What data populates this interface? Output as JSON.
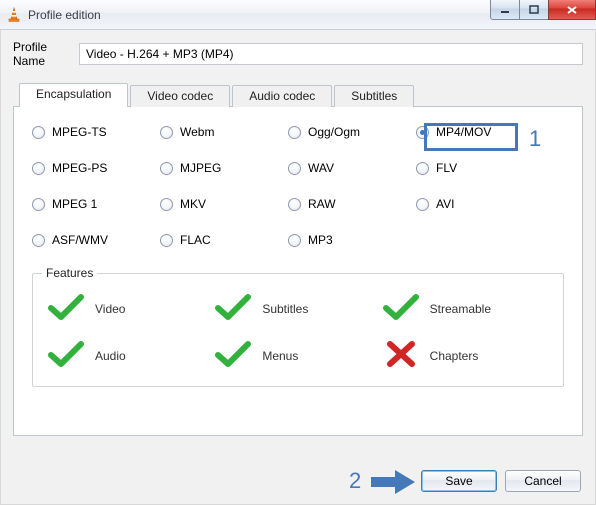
{
  "window": {
    "title": "Profile edition",
    "app_icon": "vlc-cone-icon"
  },
  "profile": {
    "name_label": "Profile Name",
    "name_value": "Video - H.264 + MP3 (MP4)"
  },
  "tabs": [
    {
      "id": "encapsulation",
      "label": "Encapsulation",
      "active": true
    },
    {
      "id": "video_codec",
      "label": "Video codec",
      "active": false
    },
    {
      "id": "audio_codec",
      "label": "Audio codec",
      "active": false
    },
    {
      "id": "subtitles",
      "label": "Subtitles",
      "active": false
    }
  ],
  "encapsulation": {
    "options": [
      {
        "id": "mpeg_ts",
        "label": "MPEG-TS",
        "selected": false
      },
      {
        "id": "webm",
        "label": "Webm",
        "selected": false
      },
      {
        "id": "ogg_ogm",
        "label": "Ogg/Ogm",
        "selected": false
      },
      {
        "id": "mp4_mov",
        "label": "MP4/MOV",
        "selected": true
      },
      {
        "id": "mpeg_ps",
        "label": "MPEG-PS",
        "selected": false
      },
      {
        "id": "mjpeg",
        "label": "MJPEG",
        "selected": false
      },
      {
        "id": "wav",
        "label": "WAV",
        "selected": false
      },
      {
        "id": "flv",
        "label": "FLV",
        "selected": false
      },
      {
        "id": "mpeg_1",
        "label": "MPEG 1",
        "selected": false
      },
      {
        "id": "mkv",
        "label": "MKV",
        "selected": false
      },
      {
        "id": "raw",
        "label": "RAW",
        "selected": false
      },
      {
        "id": "avi",
        "label": "AVI",
        "selected": false
      },
      {
        "id": "asf_wmv",
        "label": "ASF/WMV",
        "selected": false
      },
      {
        "id": "flac",
        "label": "FLAC",
        "selected": false
      },
      {
        "id": "mp3",
        "label": "MP3",
        "selected": false
      }
    ]
  },
  "features": {
    "legend": "Features",
    "items": [
      {
        "id": "video",
        "label": "Video",
        "ok": true
      },
      {
        "id": "subtitles",
        "label": "Subtitles",
        "ok": true
      },
      {
        "id": "streamable",
        "label": "Streamable",
        "ok": true
      },
      {
        "id": "audio",
        "label": "Audio",
        "ok": true
      },
      {
        "id": "menus",
        "label": "Menus",
        "ok": true
      },
      {
        "id": "chapters",
        "label": "Chapters",
        "ok": false
      }
    ]
  },
  "buttons": {
    "save": "Save",
    "cancel": "Cancel"
  },
  "annotations": {
    "callout_1": "1",
    "callout_2": "2"
  },
  "colors": {
    "callout": "#4478b8",
    "check": "#33b13d",
    "cross": "#d12626"
  }
}
